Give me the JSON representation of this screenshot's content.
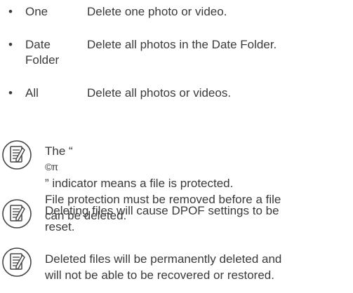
{
  "options": [
    {
      "bullet": "•",
      "term_lines": [
        "One"
      ],
      "description": "Delete one photo or video."
    },
    {
      "bullet": "•",
      "term_lines": [
        "Date",
        "Folder"
      ],
      "description": "Delete all photos in the Date Folder."
    },
    {
      "bullet": "•",
      "term_lines": [
        "All"
      ],
      "description": "Delete all photos or videos."
    }
  ],
  "notes": [
    {
      "icon": "note-icon",
      "line1_before": "The “ ",
      "line1_symbol": "©π",
      "line1_after": "” indicator means a file is protected.",
      "line2": "File protection must be removed before a file",
      "line3": "can be deleted."
    },
    {
      "icon": "note-icon",
      "line1": "Deleting files will cause DPOF settings to be",
      "line2": "reset."
    },
    {
      "icon": "note-icon",
      "line1": "Deleted files will be permanently deleted and",
      "line2": "will not be able to be recovered or restored."
    }
  ],
  "colors": {
    "text": "#3a3a3a",
    "icon_stroke": "#444444"
  }
}
